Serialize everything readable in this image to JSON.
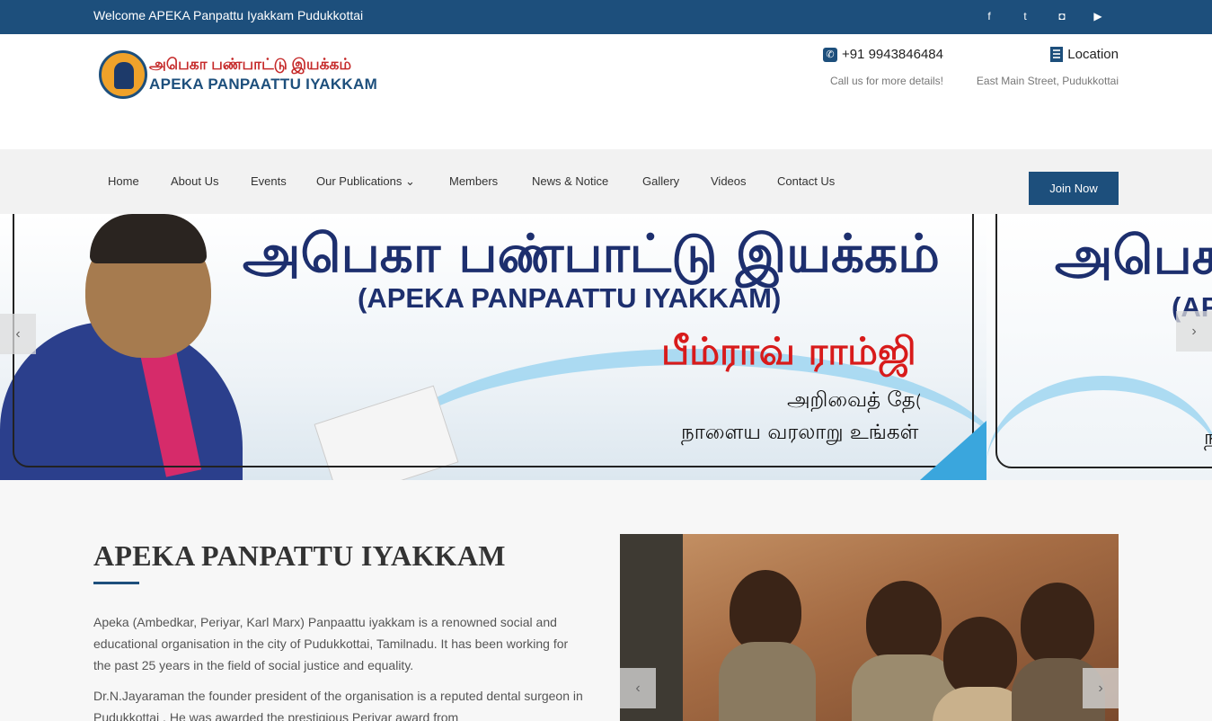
{
  "topbar": {
    "welcome": "Welcome APEKA Panpattu Iyakkam Pudukkottai",
    "social": [
      {
        "icon": "facebook-icon",
        "glyph": "f"
      },
      {
        "icon": "twitter-icon",
        "glyph": "t"
      },
      {
        "icon": "instagram-icon",
        "glyph": "◘"
      },
      {
        "icon": "youtube-icon",
        "glyph": "▶"
      }
    ]
  },
  "header": {
    "logo": {
      "tamil": "அபெகா பண்பாட்டு இயக்கம்",
      "english": "APEKA PANPAATTU IYAKKAM"
    },
    "phone": {
      "number": "+91 9943846484",
      "note": "Call us for more details!"
    },
    "location": {
      "label": "Location",
      "address": "East Main Street, Pudukkottai"
    }
  },
  "nav": {
    "items": [
      "Home",
      "About Us",
      "Events",
      "Our Publications",
      "Members",
      "News & Notice",
      "Gallery",
      "Videos",
      "Contact Us"
    ],
    "dropdown_caret": "⌄",
    "join": "Join Now"
  },
  "banner": {
    "title_tamil": "அபெகா பண்பாட்டு இயக்கம்",
    "title_english": "(APEKA PANPAATTU IYAKKAM)",
    "name_tamil": "பீம்ராவ் ராம்ஜி",
    "line1": "அறிவைத் தேடு",
    "line2": "நாளைய வரலாறு உங்கள் கை",
    "next_title_tamil": "அபெக",
    "next_title_english": "(AP",
    "next_line": "ந",
    "prev_arrow": "‹",
    "next_arrow": "›"
  },
  "about": {
    "title": "APEKA PANPATTU IYAKKAM",
    "p1": "Apeka (Ambedkar, Periyar, Karl Marx) Panpaattu iyakkam is a renowned social and educational organisation in the city of Pudukkottai, Tamilnadu. It has been working for the past 25 years in the field of social justice and equality.",
    "p2": "Dr.N.Jayaraman the founder president of the organisation is a reputed dental surgeon in Pudukkottai . He was awarded the prestigious Periyar award from",
    "prev_arrow": "‹",
    "next_arrow": "›"
  }
}
